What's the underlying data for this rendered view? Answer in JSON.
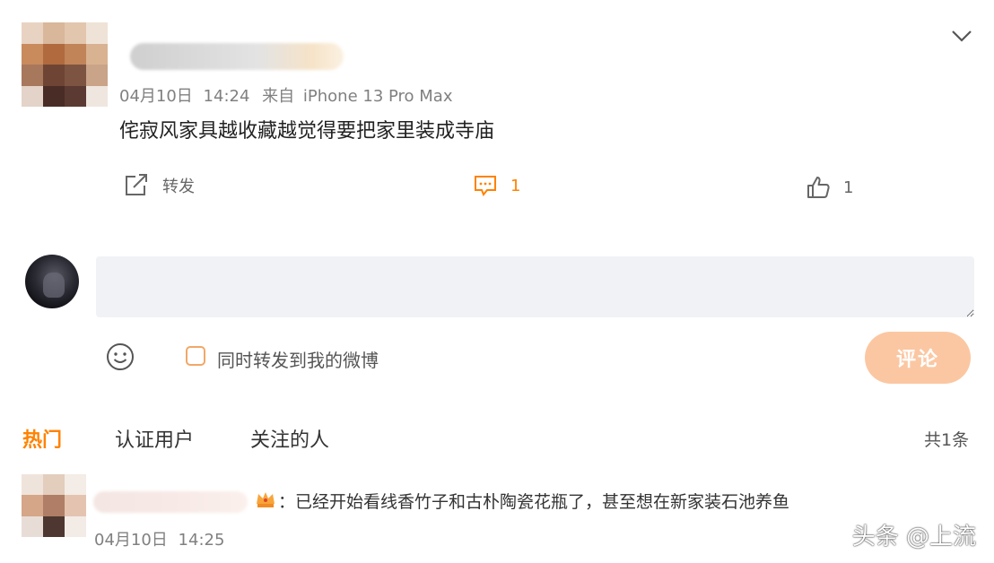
{
  "post": {
    "date": "04月10日",
    "time": "14:24",
    "source_prefix": "来自",
    "source_device": "iPhone 13 Pro Max",
    "text": "侘寂风家具越收藏越觉得要把家里装成寺庙",
    "repost_label": "转发",
    "comment_count": "1",
    "like_count": "1"
  },
  "composer": {
    "placeholder": "",
    "also_repost_label": "同时转发到我的微博",
    "submit_label": "评论"
  },
  "tabs": {
    "hot": "热门",
    "verified": "认证用户",
    "following": "关注的人"
  },
  "total_count": "共1条",
  "reply": {
    "text": "：已经开始看线香竹子和古朴陶瓷花瓶了，甚至想在新家装石池养鱼",
    "date": "04月10日",
    "time": "14:25"
  },
  "watermark": "头条 @上流",
  "colors": {
    "accent": "#ff8200",
    "submit_bg": "#fbc7a2",
    "input_bg": "#f1f2f5"
  }
}
